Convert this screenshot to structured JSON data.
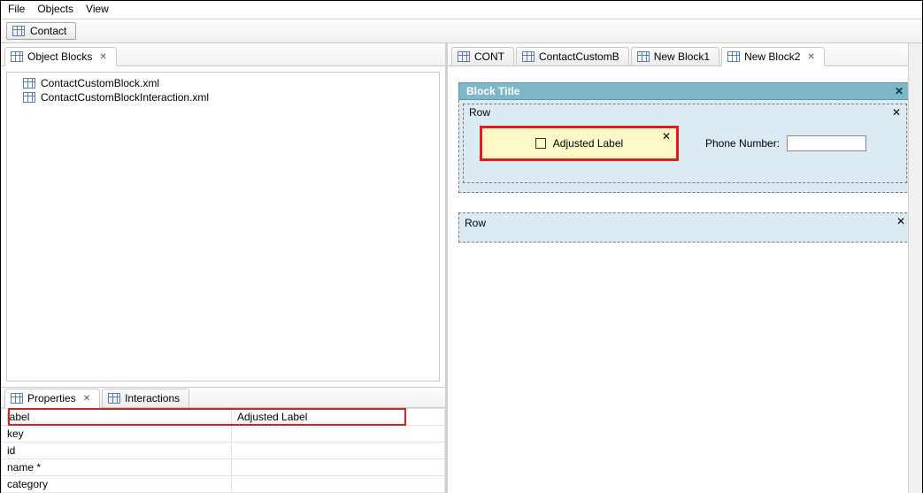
{
  "menu": {
    "file": "File",
    "objects": "Objects",
    "view": "View"
  },
  "toolbar": {
    "contact": "Contact"
  },
  "left": {
    "object_blocks_tab": "Object Blocks",
    "tree": [
      "ContactCustomBlock.xml",
      "ContactCustomBlockInteraction.xml"
    ],
    "bottom_tabs": {
      "properties": "Properties",
      "interactions": "Interactions"
    },
    "props": {
      "rows": [
        {
          "name": "label",
          "value": "Adjusted Label"
        },
        {
          "name": "key",
          "value": ""
        },
        {
          "name": "id",
          "value": ""
        },
        {
          "name": "name *",
          "value": ""
        },
        {
          "name": "category",
          "value": ""
        }
      ]
    }
  },
  "editor": {
    "tabs": [
      {
        "label": "CONT"
      },
      {
        "label": "ContactCustomB"
      },
      {
        "label": "New Block1"
      },
      {
        "label": "New Block2",
        "active": true
      }
    ],
    "block_title": "Block Title",
    "row_label": "Row",
    "adjusted_label": "Adjusted Label",
    "phone_label": "Phone Number:"
  }
}
